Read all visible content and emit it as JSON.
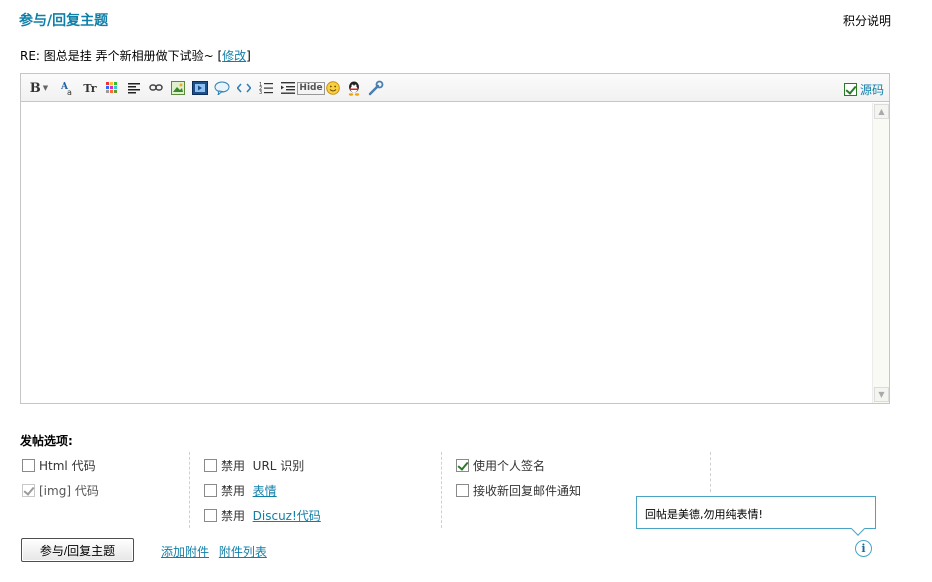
{
  "header": {
    "title": "参与/回复主题",
    "help_link": "积分说明"
  },
  "subject": {
    "text": "RE: 图总是挂 弄个新相册做下试验~ ",
    "edit_open": "[",
    "edit_label": "修改",
    "edit_close": "]"
  },
  "editor": {
    "toolbar": {
      "icons": [
        "bold-icon",
        "font-family-icon",
        "font-size-icon",
        "color-icon",
        "align-icon",
        "link-icon",
        "image-icon",
        "media-icon",
        "quote-icon",
        "code-icon",
        "ordered-list-icon",
        "indent-icon",
        "hide-icon",
        "smiley-icon",
        "qq-icon",
        "tools-icon"
      ],
      "bold_glyph": "B",
      "font_size_glyph": "Tr",
      "hide_glyph": "Hide"
    },
    "source_mode": {
      "label": "源码",
      "checked": true
    },
    "content": ""
  },
  "options": {
    "section_label": "发帖选项:",
    "html_code": {
      "label": "Html 代码",
      "checked": false
    },
    "img_code": {
      "label": "[img] 代码",
      "checked": true,
      "disabled": true
    },
    "disable_url": {
      "prefix": "禁用",
      "label": "URL 识别",
      "checked": false
    },
    "disable_smilies": {
      "prefix": "禁用",
      "label": "表情",
      "checked": false
    },
    "disable_discuz": {
      "prefix": "禁用",
      "label": "Discuz!代码",
      "checked": false
    },
    "use_signature": {
      "label": "使用个人签名",
      "checked": true
    },
    "email_notify": {
      "label": "接收新回复邮件通知",
      "checked": false
    }
  },
  "actions": {
    "submit_label": "参与/回复主题",
    "add_attachment": "添加附件",
    "attachment_list": "附件列表"
  },
  "tooltip": {
    "text": "回帖是美德,勿用纯表情!",
    "info_glyph": "i"
  },
  "colors": {
    "accent": "#0f7fa8",
    "border": "#c6c6c6",
    "tooltip_border": "#4aa3c4"
  }
}
